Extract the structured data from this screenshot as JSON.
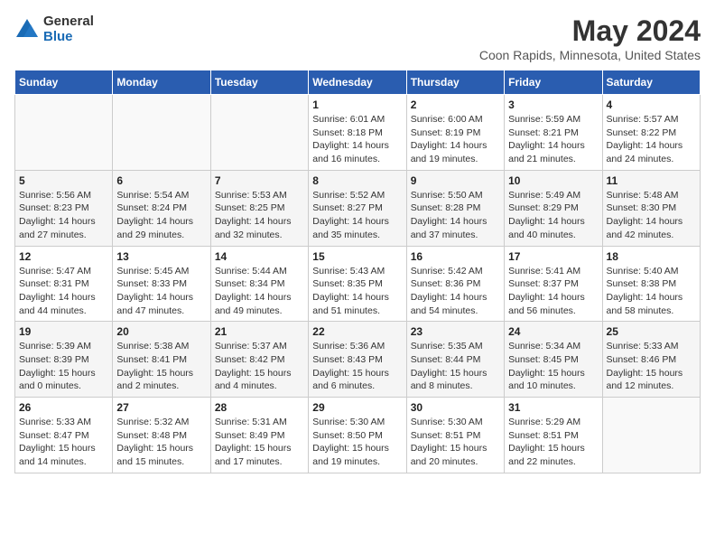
{
  "header": {
    "logo_general": "General",
    "logo_blue": "Blue",
    "title": "May 2024",
    "subtitle": "Coon Rapids, Minnesota, United States"
  },
  "weekdays": [
    "Sunday",
    "Monday",
    "Tuesday",
    "Wednesday",
    "Thursday",
    "Friday",
    "Saturday"
  ],
  "weeks": [
    [
      {
        "day": "",
        "info": ""
      },
      {
        "day": "",
        "info": ""
      },
      {
        "day": "",
        "info": ""
      },
      {
        "day": "1",
        "info": "Sunrise: 6:01 AM\nSunset: 8:18 PM\nDaylight: 14 hours\nand 16 minutes."
      },
      {
        "day": "2",
        "info": "Sunrise: 6:00 AM\nSunset: 8:19 PM\nDaylight: 14 hours\nand 19 minutes."
      },
      {
        "day": "3",
        "info": "Sunrise: 5:59 AM\nSunset: 8:21 PM\nDaylight: 14 hours\nand 21 minutes."
      },
      {
        "day": "4",
        "info": "Sunrise: 5:57 AM\nSunset: 8:22 PM\nDaylight: 14 hours\nand 24 minutes."
      }
    ],
    [
      {
        "day": "5",
        "info": "Sunrise: 5:56 AM\nSunset: 8:23 PM\nDaylight: 14 hours\nand 27 minutes."
      },
      {
        "day": "6",
        "info": "Sunrise: 5:54 AM\nSunset: 8:24 PM\nDaylight: 14 hours\nand 29 minutes."
      },
      {
        "day": "7",
        "info": "Sunrise: 5:53 AM\nSunset: 8:25 PM\nDaylight: 14 hours\nand 32 minutes."
      },
      {
        "day": "8",
        "info": "Sunrise: 5:52 AM\nSunset: 8:27 PM\nDaylight: 14 hours\nand 35 minutes."
      },
      {
        "day": "9",
        "info": "Sunrise: 5:50 AM\nSunset: 8:28 PM\nDaylight: 14 hours\nand 37 minutes."
      },
      {
        "day": "10",
        "info": "Sunrise: 5:49 AM\nSunset: 8:29 PM\nDaylight: 14 hours\nand 40 minutes."
      },
      {
        "day": "11",
        "info": "Sunrise: 5:48 AM\nSunset: 8:30 PM\nDaylight: 14 hours\nand 42 minutes."
      }
    ],
    [
      {
        "day": "12",
        "info": "Sunrise: 5:47 AM\nSunset: 8:31 PM\nDaylight: 14 hours\nand 44 minutes."
      },
      {
        "day": "13",
        "info": "Sunrise: 5:45 AM\nSunset: 8:33 PM\nDaylight: 14 hours\nand 47 minutes."
      },
      {
        "day": "14",
        "info": "Sunrise: 5:44 AM\nSunset: 8:34 PM\nDaylight: 14 hours\nand 49 minutes."
      },
      {
        "day": "15",
        "info": "Sunrise: 5:43 AM\nSunset: 8:35 PM\nDaylight: 14 hours\nand 51 minutes."
      },
      {
        "day": "16",
        "info": "Sunrise: 5:42 AM\nSunset: 8:36 PM\nDaylight: 14 hours\nand 54 minutes."
      },
      {
        "day": "17",
        "info": "Sunrise: 5:41 AM\nSunset: 8:37 PM\nDaylight: 14 hours\nand 56 minutes."
      },
      {
        "day": "18",
        "info": "Sunrise: 5:40 AM\nSunset: 8:38 PM\nDaylight: 14 hours\nand 58 minutes."
      }
    ],
    [
      {
        "day": "19",
        "info": "Sunrise: 5:39 AM\nSunset: 8:39 PM\nDaylight: 15 hours\nand 0 minutes."
      },
      {
        "day": "20",
        "info": "Sunrise: 5:38 AM\nSunset: 8:41 PM\nDaylight: 15 hours\nand 2 minutes."
      },
      {
        "day": "21",
        "info": "Sunrise: 5:37 AM\nSunset: 8:42 PM\nDaylight: 15 hours\nand 4 minutes."
      },
      {
        "day": "22",
        "info": "Sunrise: 5:36 AM\nSunset: 8:43 PM\nDaylight: 15 hours\nand 6 minutes."
      },
      {
        "day": "23",
        "info": "Sunrise: 5:35 AM\nSunset: 8:44 PM\nDaylight: 15 hours\nand 8 minutes."
      },
      {
        "day": "24",
        "info": "Sunrise: 5:34 AM\nSunset: 8:45 PM\nDaylight: 15 hours\nand 10 minutes."
      },
      {
        "day": "25",
        "info": "Sunrise: 5:33 AM\nSunset: 8:46 PM\nDaylight: 15 hours\nand 12 minutes."
      }
    ],
    [
      {
        "day": "26",
        "info": "Sunrise: 5:33 AM\nSunset: 8:47 PM\nDaylight: 15 hours\nand 14 minutes."
      },
      {
        "day": "27",
        "info": "Sunrise: 5:32 AM\nSunset: 8:48 PM\nDaylight: 15 hours\nand 15 minutes."
      },
      {
        "day": "28",
        "info": "Sunrise: 5:31 AM\nSunset: 8:49 PM\nDaylight: 15 hours\nand 17 minutes."
      },
      {
        "day": "29",
        "info": "Sunrise: 5:30 AM\nSunset: 8:50 PM\nDaylight: 15 hours\nand 19 minutes."
      },
      {
        "day": "30",
        "info": "Sunrise: 5:30 AM\nSunset: 8:51 PM\nDaylight: 15 hours\nand 20 minutes."
      },
      {
        "day": "31",
        "info": "Sunrise: 5:29 AM\nSunset: 8:51 PM\nDaylight: 15 hours\nand 22 minutes."
      },
      {
        "day": "",
        "info": ""
      }
    ]
  ]
}
